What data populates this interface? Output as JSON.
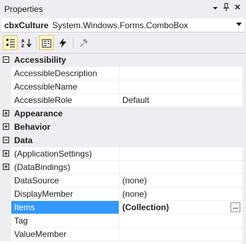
{
  "window": {
    "title": "Properties"
  },
  "object_selector": {
    "name": "cbxCulture",
    "type": "System.Windows.Forms.ComboBox"
  },
  "grid": {
    "rows": [
      {
        "kind": "category",
        "name": "Accessibility",
        "expanded": true
      },
      {
        "kind": "property",
        "name": "AccessibleDescription",
        "value": ""
      },
      {
        "kind": "property",
        "name": "AccessibleName",
        "value": ""
      },
      {
        "kind": "property",
        "name": "AccessibleRole",
        "value": "Default"
      },
      {
        "kind": "category",
        "name": "Appearance",
        "expanded": false
      },
      {
        "kind": "category",
        "name": "Behavior",
        "expanded": false
      },
      {
        "kind": "category",
        "name": "Data",
        "expanded": true
      },
      {
        "kind": "property",
        "name": "(ApplicationSettings)",
        "value": "",
        "expandable": true
      },
      {
        "kind": "property",
        "name": "(DataBindings)",
        "value": "",
        "expandable": true
      },
      {
        "kind": "property",
        "name": "DataSource",
        "value": "(none)"
      },
      {
        "kind": "property",
        "name": "DisplayMember",
        "value": "(none)"
      },
      {
        "kind": "property",
        "name": "Items",
        "value": "(Collection)",
        "selected": true,
        "ellipsis": "..."
      },
      {
        "kind": "property",
        "name": "Tag",
        "value": ""
      },
      {
        "kind": "property",
        "name": "ValueMember",
        "value": ""
      }
    ]
  },
  "colors": {
    "selection": "#3399ff",
    "chrome": "#eeeef2",
    "active_tool": "#fefcc8"
  },
  "icons": {
    "title_buttons": [
      "chevron-down-icon",
      "pin-icon",
      "close-icon"
    ],
    "toolbar": [
      "categorized-icon",
      "alphabetical-icon",
      "properties-icon",
      "events-icon",
      "property-pages-icon"
    ]
  }
}
